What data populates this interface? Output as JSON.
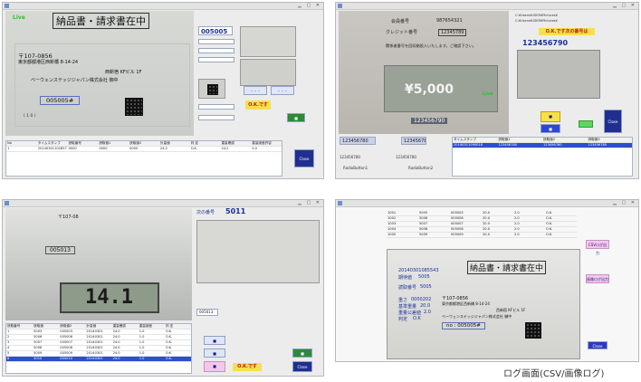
{
  "panel1": {
    "live": "Live",
    "doc_title": "納品書・請求書在中",
    "postal": "〒107-0856",
    "address": "東京都都港区西新橋 8-14-24",
    "building": "西新宿 KFビル 1F",
    "company": "ベーウェンステッジジャパン株式会社 御中",
    "code": "005005#",
    "paren": "( 1 0 )",
    "big_number": "005005",
    "ok": "O.K.です",
    "close": "Close",
    "table_headers": [
      "No",
      "タイムスタンプ",
      "読取番号",
      "読取値1",
      "読取値2",
      "計量値",
      "判 定",
      "重量確認",
      "重量誤差許容"
    ],
    "table_rows": [
      [
        "1",
        "20140301102857",
        "0000",
        "0000",
        "0000",
        "24.2",
        "O.K.",
        "24.2",
        "0.0"
      ]
    ]
  },
  "panel2": {
    "member_label": "会員番号",
    "member_value": "987654321",
    "card_label": "クレジット番号",
    "card_value": "12345789",
    "note": "関係者番号を回収箱投入いたします。ご確認下さい。",
    "amount": "¥5,000",
    "live": "Live",
    "scan_number": "123456790",
    "ok_text": "O.K.です次の番号は",
    "top_path1": "C:¥Users¥USER¥Pictures¥",
    "top_path2": "C:¥Users¥USER¥Pictures¥",
    "left_number": "123456780",
    "left_number2": "123456780",
    "radio1": "RadioButton1",
    "radio2": "RadioButton2",
    "table_headers": [
      "タイムスタンプ",
      "読取値1",
      "読取値2",
      "読取値3"
    ],
    "selected_row": [
      "20140311090018",
      "123456780",
      "123456780",
      "123456780"
    ],
    "close": "Close"
  },
  "panel3": {
    "next_label": "次の番号",
    "next_value": "5011",
    "scale_reading": "14.1",
    "code": "005013",
    "address_label": "〒107-08",
    "ok": "O.K.です",
    "close": "Close",
    "table_headers": [
      "読取番号",
      "読取値",
      "読取値2",
      "計量値",
      "重量確認",
      "重量誤差",
      "判 定"
    ],
    "table_rows": [
      [
        "1",
        "5003",
        "005003",
        "20140301",
        "24.0",
        "1.0",
        "O.K."
      ],
      [
        "2",
        "5006",
        "005006",
        "20140301",
        "24.0",
        "1.0",
        "O.K."
      ],
      [
        "3",
        "5007",
        "005007",
        "20140301",
        "24.0",
        "1.0",
        "O.K."
      ],
      [
        "4",
        "5008",
        "005008",
        "20140301",
        "24.0",
        "1.0",
        "O.K."
      ],
      [
        "5",
        "5009",
        "005009",
        "20140301",
        "24.0",
        "1.0",
        "O.K."
      ],
      [
        "6",
        "5010",
        "005010",
        "20140301",
        "24.0",
        "1.0",
        "O.K."
      ]
    ]
  },
  "panel4": {
    "timestamp": "20140301085543",
    "expected_label": "期待値",
    "expected_value": "5005",
    "doc_title": "納品書・請求書在中",
    "read_label": "読取番号",
    "read_value": "5005",
    "weight_label": "重さ",
    "weight_value": "0000202",
    "ref_weight_label": "基準重量",
    "ref_weight_value": "20.0",
    "tolerance_label": "重量公差値",
    "tolerance_value": "2.0",
    "judge_label": "判定",
    "judge_value": "O.K",
    "postal": "〒107-0856",
    "address": "東京都都港区西新橋 8-14-24",
    "building": "西新宿 KFビル 1F",
    "company": "ベーウェンステッジジャパン株式会社 御中",
    "code": "no : 005005#",
    "button1": "CSVログ出力",
    "button2": "画像ログ出力",
    "close": "Close",
    "log_rows": [
      [
        "1001",
        "5005",
        "005005",
        "20.0",
        "2.0",
        "O.K."
      ],
      [
        "1002",
        "5006",
        "005006",
        "20.0",
        "2.0",
        "O.K."
      ],
      [
        "1003",
        "5007",
        "005007",
        "20.0",
        "2.0",
        "O.K."
      ],
      [
        "1004",
        "5008",
        "005008",
        "20.0",
        "2.0",
        "O.K."
      ],
      [
        "1005",
        "5009",
        "005009",
        "20.0",
        "2.0",
        "O.K."
      ]
    ]
  },
  "caption": "ログ画面(CSV/画像ログ)"
}
